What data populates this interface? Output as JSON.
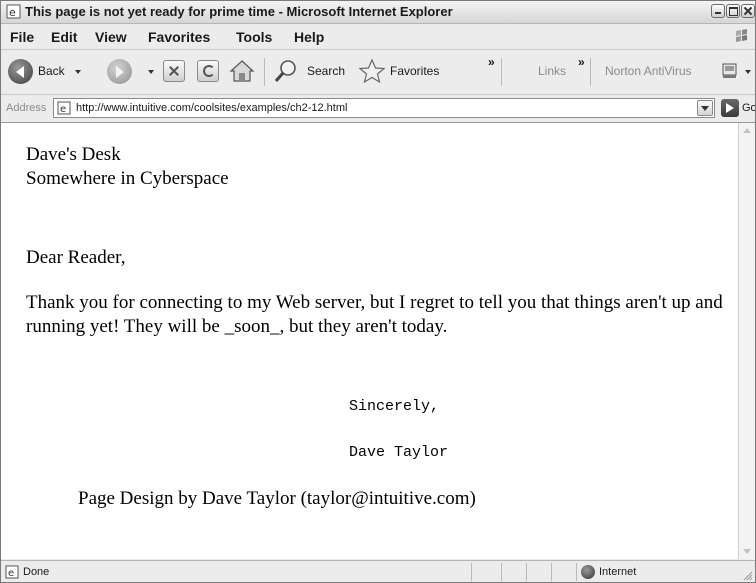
{
  "window": {
    "title": "This page is not yet ready for prime time - Microsoft Internet Explorer"
  },
  "menubar": {
    "items": [
      "File",
      "Edit",
      "View",
      "Favorites",
      "Tools",
      "Help"
    ]
  },
  "toolbar": {
    "back_label": "Back",
    "search_label": "Search",
    "favorites_label": "Favorites",
    "links_label": "Links",
    "norton_label": "Norton AntiVirus",
    "chevron": "»"
  },
  "addressbar": {
    "label": "Address",
    "url": "http://www.intuitive.com/coolsites/examples/ch2-12.html",
    "go_label": "Go"
  },
  "content": {
    "line1": "Dave's Desk",
    "line2": "Somewhere in Cyberspace",
    "greeting": "Dear Reader,",
    "paragraph": "Thank you for connecting to my Web server, but I regret to tell you that things aren't up and running yet! They will be _soon_, but they aren't today.",
    "closing": "Sincerely,",
    "signature": "Dave Taylor",
    "footer": "Page Design by Dave Taylor (taylor@intuitive.com)"
  },
  "statusbar": {
    "status": "Done",
    "zone": "Internet"
  }
}
